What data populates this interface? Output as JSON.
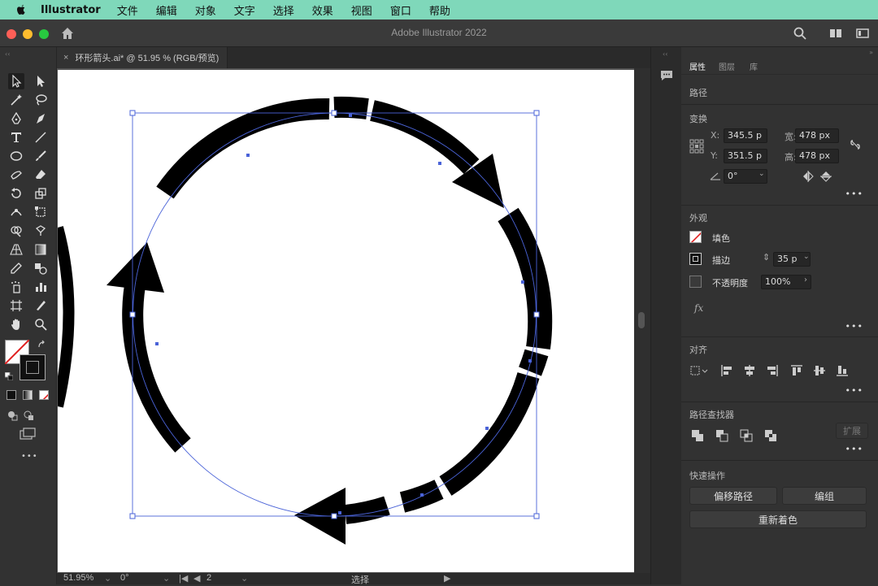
{
  "menubar": {
    "app_name": "Illustrator",
    "items": [
      "文件",
      "编辑",
      "对象",
      "文字",
      "选择",
      "效果",
      "视图",
      "窗口",
      "帮助"
    ]
  },
  "window": {
    "title": "Adobe Illustrator 2022"
  },
  "document_tab": {
    "close": "×",
    "name": "环形箭头.ai* @ 51.95 % (RGB/预览)"
  },
  "panel": {
    "tabs": [
      "属性",
      "图层",
      "库"
    ],
    "object_type": "路径",
    "transform": {
      "title": "变换",
      "x_label": "X:",
      "x_value": "345.5 p",
      "y_label": "Y:",
      "y_value": "351.5 p",
      "w_label": "宽:",
      "w_value": "478 px",
      "h_label": "高:",
      "h_value": "478 px",
      "angle_value": "0°"
    },
    "appearance": {
      "title": "外观",
      "fill_label": "填色",
      "stroke_label": "描边",
      "stroke_value": "35 p",
      "opacity_label": "不透明度",
      "opacity_value": "100%",
      "fx_label": "fx"
    },
    "align": {
      "title": "对齐"
    },
    "pathfinder": {
      "title": "路径查找器",
      "expand_label": "扩展"
    },
    "quick_actions": {
      "title": "快速操作",
      "offset_path": "偏移路径",
      "group": "编组",
      "recolor": "重新着色"
    },
    "more": "•••"
  },
  "status": {
    "zoom": "51.95%",
    "angle": "0°",
    "artboard": "2",
    "tool": "选择"
  },
  "toolbar": {
    "more": "•••"
  },
  "colors": {
    "menubar_bg": "#7fd8ba",
    "selection_blue": "#4a63d8",
    "arrow_fill": "#000000"
  }
}
